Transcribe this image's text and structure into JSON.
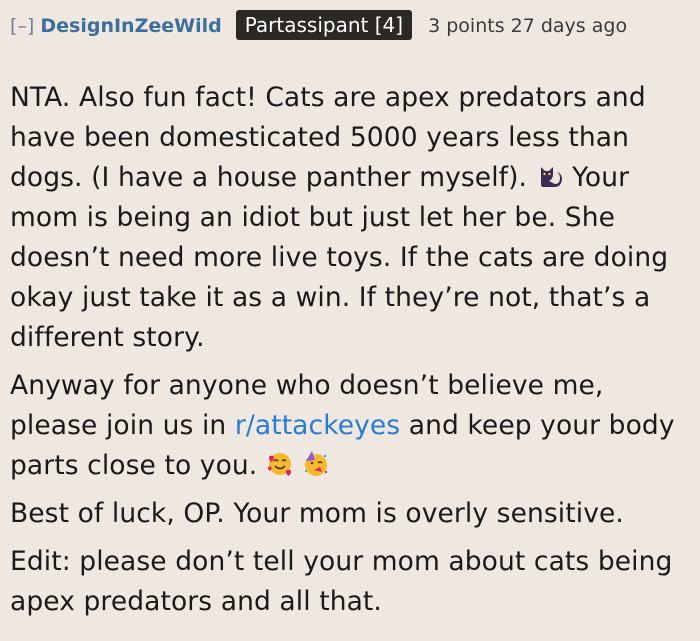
{
  "comment": {
    "collapse_label": "[–]",
    "author": "DesignInZeeWild",
    "flair": "Partassipant [4]",
    "score": "3 points",
    "age": "27 days ago",
    "paragraphs": {
      "p1_a": "NTA. Also fun fact! Cats are apex predators and have been domesticated 5000 years less than dogs. (I have a house panther myself).",
      "p1_b": "Your mom is being an idiot but just let her be. She doesn’t need more live toys. If the cats are doing okay just take it as a win. If they’re not, that’s a different story.",
      "p2_a": "Anyway for anyone who doesn’t believe me, please join us in",
      "p2_link": "r/attackeyes",
      "p2_b": "and keep your body parts close to you.",
      "p3": "Best of luck, OP. Your mom is overly sensitive.",
      "p4": "Edit: please don’t tell your mom about cats being apex predators and all that."
    },
    "icons": [
      "black-cat-icon",
      "smiling-face-with-hearts-icon",
      "partying-face-icon"
    ]
  }
}
